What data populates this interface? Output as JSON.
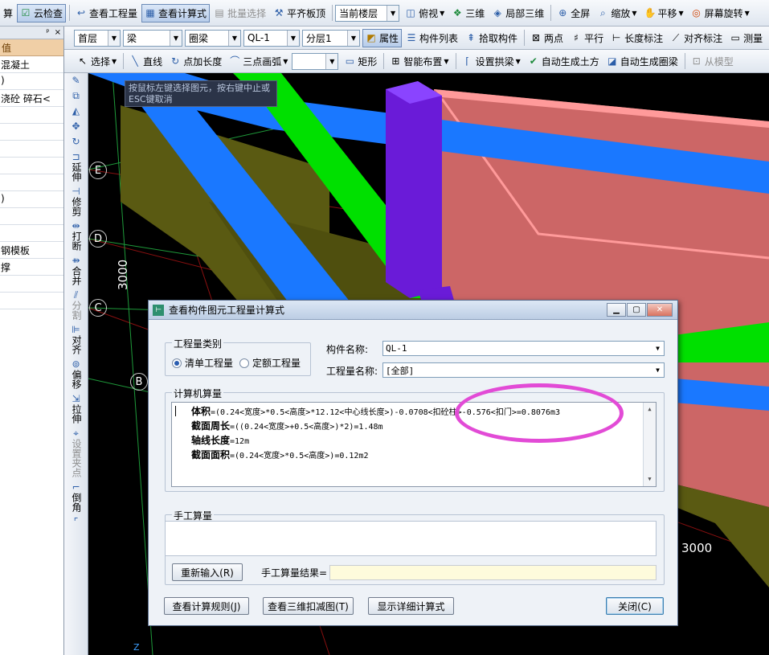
{
  "toolbar1": {
    "items": [
      {
        "icon": "calc-icon",
        "label": "算"
      },
      {
        "icon": "cloud-check-icon",
        "label": "云检查"
      },
      {
        "icon": "view-quantity-icon",
        "label": "查看工程量"
      },
      {
        "icon": "view-formula-icon",
        "label": "查看计算式"
      },
      {
        "icon": "batch-select-icon",
        "label": "批量选择"
      },
      {
        "icon": "align-top-icon",
        "label": "平齐板顶"
      },
      {
        "icon": "top-view-icon",
        "label": "俯视"
      },
      {
        "icon": "3d-icon",
        "label": "三维"
      },
      {
        "icon": "local-3d-icon",
        "label": "局部三维"
      },
      {
        "icon": "fullscreen-icon",
        "label": "全屏"
      },
      {
        "icon": "zoom-icon",
        "label": "缩放"
      },
      {
        "icon": "pan-icon",
        "label": "平移"
      },
      {
        "icon": "rotate-icon",
        "label": "屏幕旋转"
      }
    ],
    "floor_select": "当前楼层"
  },
  "toolbar2": {
    "floor": "首层",
    "type": "梁",
    "subtype": "圈梁",
    "element": "QL-1",
    "layer": "分层1",
    "items": [
      {
        "icon": "properties-icon",
        "label": "属性"
      },
      {
        "icon": "component-list-icon",
        "label": "构件列表"
      },
      {
        "icon": "pick-icon",
        "label": "拾取构件"
      },
      {
        "icon": "two-point-icon",
        "label": "两点"
      },
      {
        "icon": "parallel-icon",
        "label": "平行"
      },
      {
        "icon": "length-dim-icon",
        "label": "长度标注"
      },
      {
        "icon": "align-dim-icon",
        "label": "对齐标注"
      },
      {
        "icon": "measure-icon",
        "label": "测量"
      }
    ]
  },
  "toolbar3": {
    "items": [
      {
        "icon": "select-icon",
        "label": "选择"
      },
      {
        "icon": "line-icon",
        "label": "直线"
      },
      {
        "icon": "point-length-icon",
        "label": "点加长度"
      },
      {
        "icon": "arc-icon",
        "label": "三点画弧"
      },
      {
        "icon": "rect-icon",
        "label": "矩形"
      },
      {
        "icon": "smart-layout-icon",
        "label": "智能布置"
      },
      {
        "icon": "arch-icon",
        "label": "设置拱梁"
      },
      {
        "icon": "auto-earthwork-icon",
        "label": "自动生成土方"
      },
      {
        "icon": "auto-ring-beam-icon",
        "label": "自动生成圈梁"
      },
      {
        "icon": "from-model-icon",
        "label": "从模型"
      }
    ]
  },
  "left_panel": {
    "pin": "ᵖ",
    "close": "×",
    "header": "值",
    "rows": [
      "混凝土",
      ")",
      "浇砼 碎石<",
      "",
      "",
      "",
      "",
      "",
      ")",
      "",
      "",
      "钢模板",
      "撑",
      "",
      ""
    ]
  },
  "vertical_tools": [
    {
      "icon": "brush-icon",
      "label": ""
    },
    {
      "icon": "copy-icon",
      "label": ""
    },
    {
      "icon": "mirror-icon",
      "label": ""
    },
    {
      "icon": "move-icon",
      "label": ""
    },
    {
      "icon": "rotate-cw-icon",
      "label": ""
    },
    {
      "icon": "extend-icon",
      "label": "延伸"
    },
    {
      "icon": "trim-icon",
      "label": "修剪"
    },
    {
      "icon": "break-icon",
      "label": "打断"
    },
    {
      "icon": "merge-icon",
      "label": "合并"
    },
    {
      "icon": "split-icon",
      "label": "分割"
    },
    {
      "icon": "align-icon",
      "label": "对齐"
    },
    {
      "icon": "offset-icon",
      "label": "偏移"
    },
    {
      "icon": "stretch-icon",
      "label": "拉伸"
    },
    {
      "icon": "grip-icon",
      "label": "设置夹点"
    },
    {
      "icon": "chamfer-icon",
      "label": "倒角"
    },
    {
      "icon": "fillet-icon",
      "label": ""
    }
  ],
  "viewport": {
    "hint": "按鼠标左键选择图元，按右键中止或ESC键取消",
    "axis_labels": [
      "E",
      "D",
      "C",
      "B"
    ],
    "dim_left": "3000",
    "dim_right": "3000",
    "z_label": "Z"
  },
  "dialog": {
    "title": "查看构件图元工程量计算式",
    "quantity_type": {
      "label": "工程量类别",
      "options": [
        {
          "label": "清单工程量",
          "selected": true
        },
        {
          "label": "定额工程量",
          "selected": false
        }
      ]
    },
    "component_name_label": "构件名称:",
    "component_name": "QL-1",
    "quantity_name_label": "工程量名称:",
    "quantity_name": "[全部]",
    "computed": {
      "label": "计算机算量",
      "lines": [
        {
          "name": "体积",
          "formula": "=(0.24<宽度>*0.5<高度>*12.12<中心线长度>)-0.0708<扣砼柱>-0.576<扣门>=0.8076m3"
        },
        {
          "name": "截面周长",
          "formula": "=((0.24<宽度>+0.5<高度>)*2)=1.48m"
        },
        {
          "name": "轴线长度",
          "formula": "=12m"
        },
        {
          "name": "截面面积",
          "formula": "=(0.24<宽度>*0.5<高度>)=0.12m2"
        }
      ]
    },
    "manual": {
      "label": "手工算量",
      "reinput": "重新输入(R)",
      "result_label": "手工算量结果=",
      "result": ""
    },
    "buttons": {
      "rules": "查看计算规则(J)",
      "view3d": "查看三维扣减图(T)",
      "detail": "显示详细计算式",
      "close": "关闭(C)"
    },
    "window_buttons": {
      "min": "▁",
      "max": "▢",
      "close": "✕"
    }
  },
  "colors": {
    "beam_green": "#00e000",
    "beam_blue": "#1a78ff",
    "wall_olive": "#5a5a12",
    "slab_pink": "#cc6666",
    "column_purple": "#6a1bd8",
    "annotation_magenta": "#e24bd6"
  }
}
